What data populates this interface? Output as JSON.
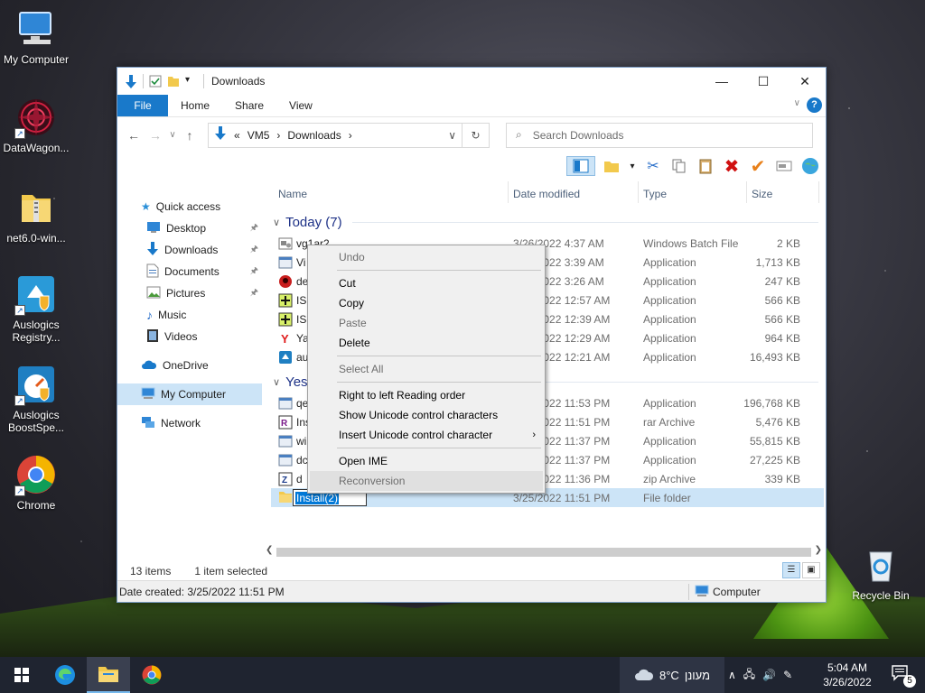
{
  "desktop": {
    "icons": [
      {
        "label": "My Computer",
        "icon": "monitor-icon"
      },
      {
        "label": "DataWagon...",
        "icon": "mandala-icon"
      },
      {
        "label": "net6.0-win...",
        "icon": "folder-zip-icon"
      },
      {
        "label": "Auslogics Registry...",
        "icon": "auslogics-registry-icon"
      },
      {
        "label": "Auslogics BoostSpe...",
        "icon": "auslogics-boost-icon"
      },
      {
        "label": "Chrome",
        "icon": "chrome-icon"
      },
      {
        "label": "Recycle Bin",
        "icon": "recycle-bin-icon"
      }
    ]
  },
  "window": {
    "title": "Downloads",
    "ribbon_tabs": [
      "File",
      "Home",
      "Share",
      "View"
    ],
    "address": {
      "chevron": "«",
      "crumbs": [
        "VM5",
        "Downloads"
      ]
    },
    "search_placeholder": "Search Downloads",
    "columns": [
      "Name",
      "Date modified",
      "Type",
      "Size"
    ],
    "nav": [
      {
        "label": "Quick access",
        "icon": "star-icon",
        "level": 0
      },
      {
        "label": "Desktop",
        "icon": "desktop-icon",
        "level": 1,
        "pinned": true
      },
      {
        "label": "Downloads",
        "icon": "download-arrow-icon",
        "level": 1,
        "pinned": true
      },
      {
        "label": "Documents",
        "icon": "document-icon",
        "level": 1,
        "pinned": true
      },
      {
        "label": "Pictures",
        "icon": "picture-icon",
        "level": 1,
        "pinned": true
      },
      {
        "label": "Music",
        "icon": "music-icon",
        "level": 1,
        "pinned": false
      },
      {
        "label": "Videos",
        "icon": "video-icon",
        "level": 1,
        "pinned": false
      },
      {
        "label": "OneDrive",
        "icon": "cloud-icon",
        "level": 0
      },
      {
        "label": "My Computer",
        "icon": "monitor-icon",
        "level": 0,
        "selected": true
      },
      {
        "label": "Network",
        "icon": "network-icon",
        "level": 0
      }
    ],
    "groups": [
      {
        "label": "Today (7)",
        "rows": [
          {
            "name": "vg1ar2",
            "date": "3/26/2022 4:37 AM",
            "type": "Windows Batch File",
            "size": "2 KB",
            "icon": "batch-file-icon"
          },
          {
            "name": "Vi",
            "date": "3/26/2022 3:39 AM",
            "type": "Application",
            "size": "1,713 KB",
            "icon": "app-icon"
          },
          {
            "name": "de",
            "date": "3/26/2022 3:26 AM",
            "type": "Application",
            "size": "247 KB",
            "icon": "app-red-icon"
          },
          {
            "name": "ISL",
            "date": "3/26/2022 12:57 AM",
            "type": "Application",
            "size": "566 KB",
            "icon": "app-green-icon"
          },
          {
            "name": "ISL",
            "date": "3/26/2022 12:39 AM",
            "type": "Application",
            "size": "566 KB",
            "icon": "app-green-icon"
          },
          {
            "name": "Ya",
            "date": "3/26/2022 12:29 AM",
            "type": "Application",
            "size": "964 KB",
            "icon": "yandex-icon"
          },
          {
            "name": "au",
            "date": "3/26/2022 12:21 AM",
            "type": "Application",
            "size": "16,493 KB",
            "icon": "app-blue-icon"
          }
        ]
      },
      {
        "label": "Yeste",
        "rows": [
          {
            "name": "qe",
            "date": "3/25/2022 11:53 PM",
            "type": "Application",
            "size": "196,768 KB",
            "icon": "app-icon"
          },
          {
            "name": "Ins",
            "date": "3/25/2022 11:51 PM",
            "type": "rar Archive",
            "size": "5,476 KB",
            "icon": "rar-icon"
          },
          {
            "name": "wi",
            "date": "3/25/2022 11:37 PM",
            "type": "Application",
            "size": "55,815 KB",
            "icon": "app-icon"
          },
          {
            "name": "dc",
            "date": "3/25/2022 11:37 PM",
            "type": "Application",
            "size": "27,225 KB",
            "icon": "app-icon"
          },
          {
            "name": "d",
            "date": "3/25/2022 11:36 PM",
            "type": "zip Archive",
            "size": "339 KB",
            "icon": "zip-icon"
          },
          {
            "name": "Install(2)",
            "date": "3/25/2022 11:51 PM",
            "type": "File folder",
            "size": "",
            "icon": "folder-icon",
            "selected": true,
            "renaming": true
          }
        ]
      }
    ],
    "status": {
      "items": "13 items",
      "selected": "1 item selected"
    },
    "details": {
      "created": "Date created: 3/25/2022 11:51 PM",
      "location": "Computer"
    }
  },
  "context_menu": {
    "items": [
      {
        "label": "Undo",
        "disabled": true
      },
      {
        "sep": true
      },
      {
        "label": "Cut",
        "disabled": false
      },
      {
        "label": "Copy",
        "disabled": false
      },
      {
        "label": "Paste",
        "disabled": true
      },
      {
        "label": "Delete",
        "disabled": false
      },
      {
        "sep": true
      },
      {
        "label": "Select All",
        "disabled": true
      },
      {
        "sep": true
      },
      {
        "label": "Right to left Reading order",
        "disabled": false
      },
      {
        "label": "Show Unicode control characters",
        "disabled": false
      },
      {
        "label": "Insert Unicode control character",
        "disabled": false,
        "submenu": true
      },
      {
        "sep": true
      },
      {
        "label": "Open IME",
        "disabled": false
      },
      {
        "label": "Reconversion",
        "disabled": true,
        "hover": true
      }
    ]
  },
  "taskbar": {
    "weather_temp": "8°C",
    "weather_text": "מעונן",
    "time": "5:04 AM",
    "date": "3/26/2022",
    "notification_count": "5"
  },
  "colors": {
    "accent": "#1979ca",
    "selection": "#cce4f7",
    "taskbar": "#1f2430"
  }
}
